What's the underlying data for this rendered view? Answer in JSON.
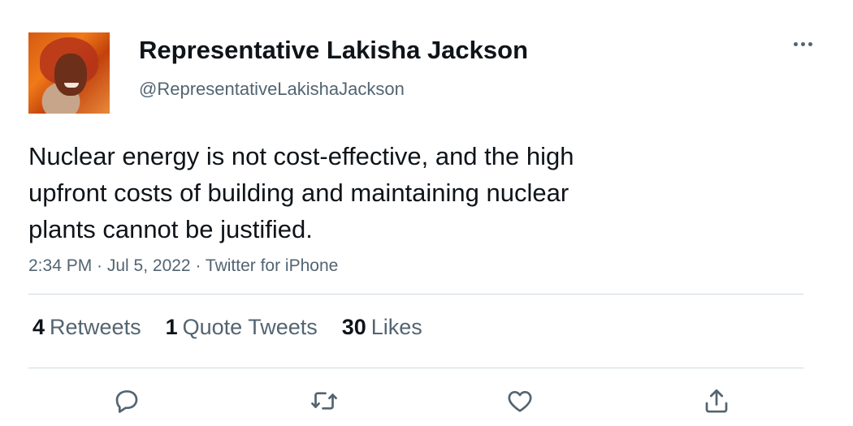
{
  "author": {
    "name": "Representative Lakisha Jackson",
    "handle": "@RepresentativeLakishaJackson"
  },
  "tweet": {
    "text_lines": [
      "Nuclear energy is not cost-effective, and the high",
      "upfront costs of building and maintaining nuclear",
      "plants cannot be justified."
    ],
    "meta": "2:34 PM · Jul 5, 2022 · Twitter for iPhone"
  },
  "stats": {
    "retweets_count": "4",
    "retweets_label": "Retweets",
    "quotes_count": "1",
    "quotes_label": "Quote Tweets",
    "likes_count": "30",
    "likes_label": "Likes"
  },
  "icons": {
    "reply": "reply-icon",
    "retweet": "retweet-icon",
    "like": "like-icon",
    "share": "share-icon",
    "more": "more-icon"
  },
  "colors": {
    "text": "#0f1419",
    "secondary": "#536471",
    "divider": "#cfd9de"
  }
}
